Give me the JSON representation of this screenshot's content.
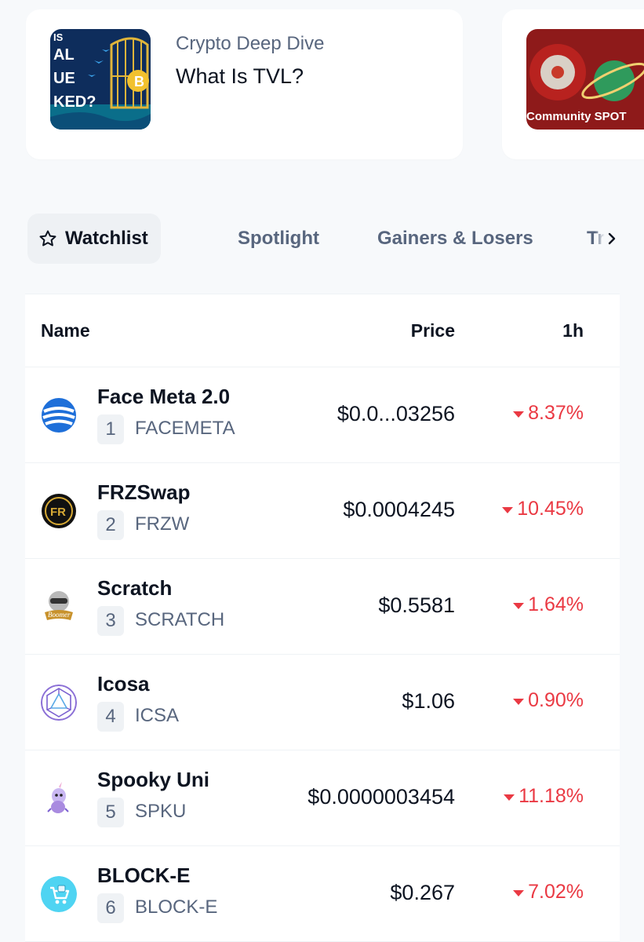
{
  "cards": [
    {
      "category": "Crypto Deep Dive",
      "title": "What Is TVL?",
      "thumb_lines": [
        "IS",
        "AL",
        "UE",
        "KED?"
      ],
      "icon": "bitcoin-birdcage-thumbnail"
    },
    {
      "label": "Community SPOT",
      "icon": "community-spotlight-thumbnail"
    }
  ],
  "tabs": [
    {
      "label": "Watchlist",
      "icon": "star-icon",
      "active": true
    },
    {
      "label": "Spotlight"
    },
    {
      "label": "Gainers & Losers"
    },
    {
      "label": "Tre"
    }
  ],
  "tab_more_icon": "chevron-right-icon",
  "table": {
    "headers": {
      "name": "Name",
      "price": "Price",
      "change": "1h"
    },
    "rows": [
      {
        "rank": "1",
        "name": "Face Meta 2.0",
        "symbol": "FACEMETA",
        "price": "$0.0...03256",
        "change": "8.37%",
        "icon": "face-meta-logo"
      },
      {
        "rank": "2",
        "name": "FRZSwap",
        "symbol": "FRZW",
        "price": "$0.0004245",
        "change": "10.45%",
        "icon": "frzswap-logo"
      },
      {
        "rank": "3",
        "name": "Scratch",
        "symbol": "SCRATCH",
        "price": "$0.5581",
        "change": "1.64%",
        "icon": "scratch-logo"
      },
      {
        "rank": "4",
        "name": "Icosa",
        "symbol": "ICSA",
        "price": "$1.06",
        "change": "0.90%",
        "icon": "icosa-logo"
      },
      {
        "rank": "5",
        "name": "Spooky Uni",
        "symbol": "SPKU",
        "price": "$0.0000003454",
        "change": "11.18%",
        "icon": "spooky-uni-logo"
      },
      {
        "rank": "6",
        "name": "BLOCK-E",
        "symbol": "BLOCK-E",
        "price": "$0.267",
        "change": "7.02%",
        "icon": "block-e-logo"
      }
    ]
  },
  "colors": {
    "down": "#ea3943",
    "muted": "#58667e",
    "text": "#0d1421"
  }
}
